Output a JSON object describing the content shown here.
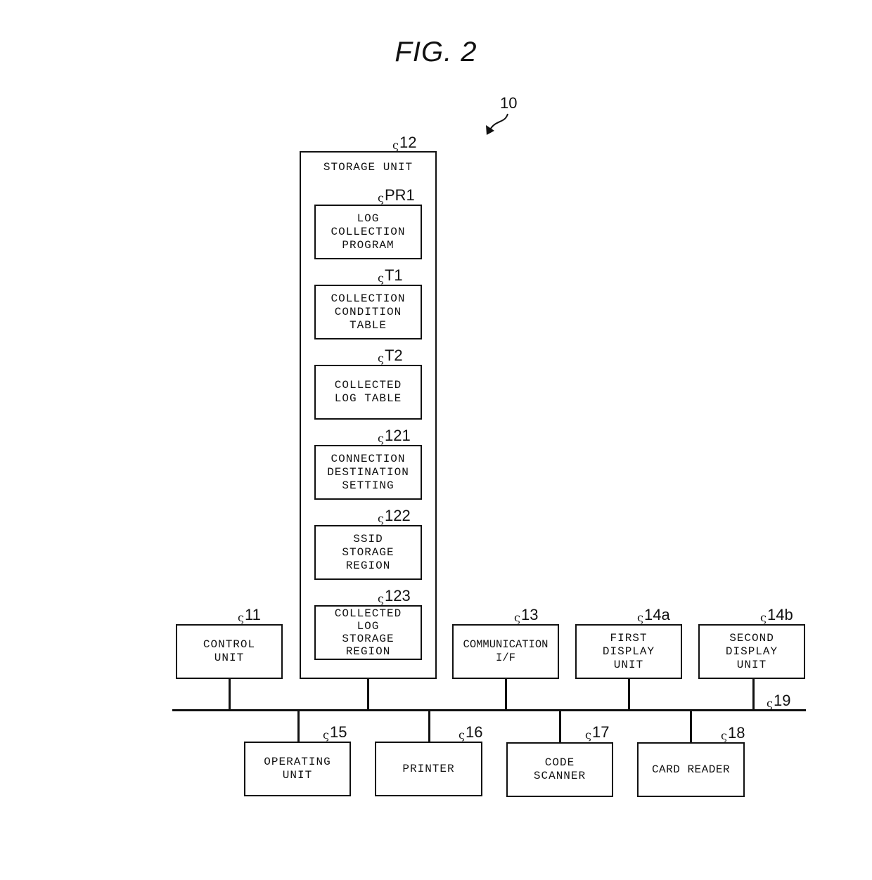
{
  "figure": {
    "title": "FIG. 2",
    "system_ref": "10"
  },
  "storage_unit": {
    "label": "STORAGE UNIT",
    "ref": "12",
    "items": [
      {
        "ref": "PR1",
        "label": "LOG\nCOLLECTION\nPROGRAM"
      },
      {
        "ref": "T1",
        "label": "COLLECTION\nCONDITION\nTABLE"
      },
      {
        "ref": "T2",
        "label": "COLLECTED\nLOG TABLE"
      },
      {
        "ref": "121",
        "label": "CONNECTION\nDESTINATION\nSETTING"
      },
      {
        "ref": "122",
        "label": "SSID\nSTORAGE\nREGION"
      },
      {
        "ref": "123",
        "label": "COLLECTED\nLOG\nSTORAGE\nREGION"
      }
    ]
  },
  "upper_units": [
    {
      "ref": "11",
      "label": "CONTROL\nUNIT"
    },
    {
      "ref": "13",
      "label": "COMMUNICATION\nI/F"
    },
    {
      "ref": "14a",
      "label": "FIRST\nDISPLAY\nUNIT"
    },
    {
      "ref": "14b",
      "label": "SECOND\nDISPLAY\nUNIT"
    }
  ],
  "bus": {
    "ref": "19"
  },
  "lower_units": [
    {
      "ref": "15",
      "label": "OPERATING\nUNIT"
    },
    {
      "ref": "16",
      "label": "PRINTER"
    },
    {
      "ref": "17",
      "label": "CODE\nSCANNER"
    },
    {
      "ref": "18",
      "label": "CARD READER"
    }
  ],
  "leader_glyph": "ς"
}
